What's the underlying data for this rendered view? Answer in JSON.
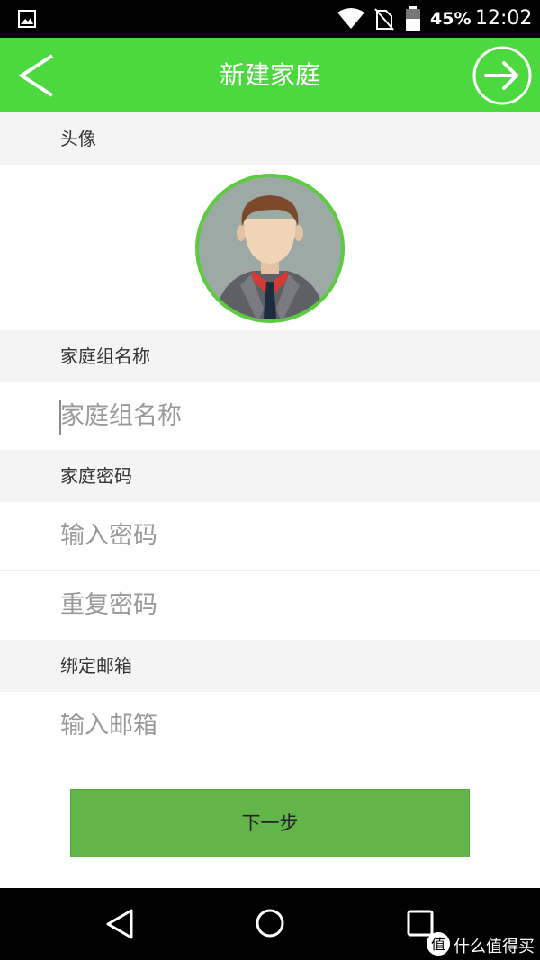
{
  "status_bar": {
    "battery_percent": "45%",
    "time": "12:02",
    "icons": [
      "gallery-icon",
      "wifi-icon",
      "no-sim-icon",
      "battery-icon"
    ]
  },
  "header": {
    "title": "新建家庭",
    "back_icon": "chevron-left-icon",
    "next_icon": "arrow-right-circle-icon"
  },
  "sections": {
    "avatar_label": "头像",
    "group_name_label": "家庭组名称",
    "password_label": "家庭密码",
    "email_label": "绑定邮箱"
  },
  "fields": {
    "group_name_placeholder": "家庭组名称",
    "password_placeholder": "输入密码",
    "repeat_password_placeholder": "重复密码",
    "email_placeholder": "输入邮箱"
  },
  "button": {
    "next_step_label": "下一步"
  },
  "nav_bar": {
    "icons": [
      "nav-back-icon",
      "nav-home-icon",
      "nav-recent-icon"
    ]
  },
  "watermark": {
    "text": "什么值得买"
  },
  "colors": {
    "header_green": "#4cd93f",
    "button_green": "#62b548",
    "avatar_ring": "#5ccc3f"
  }
}
